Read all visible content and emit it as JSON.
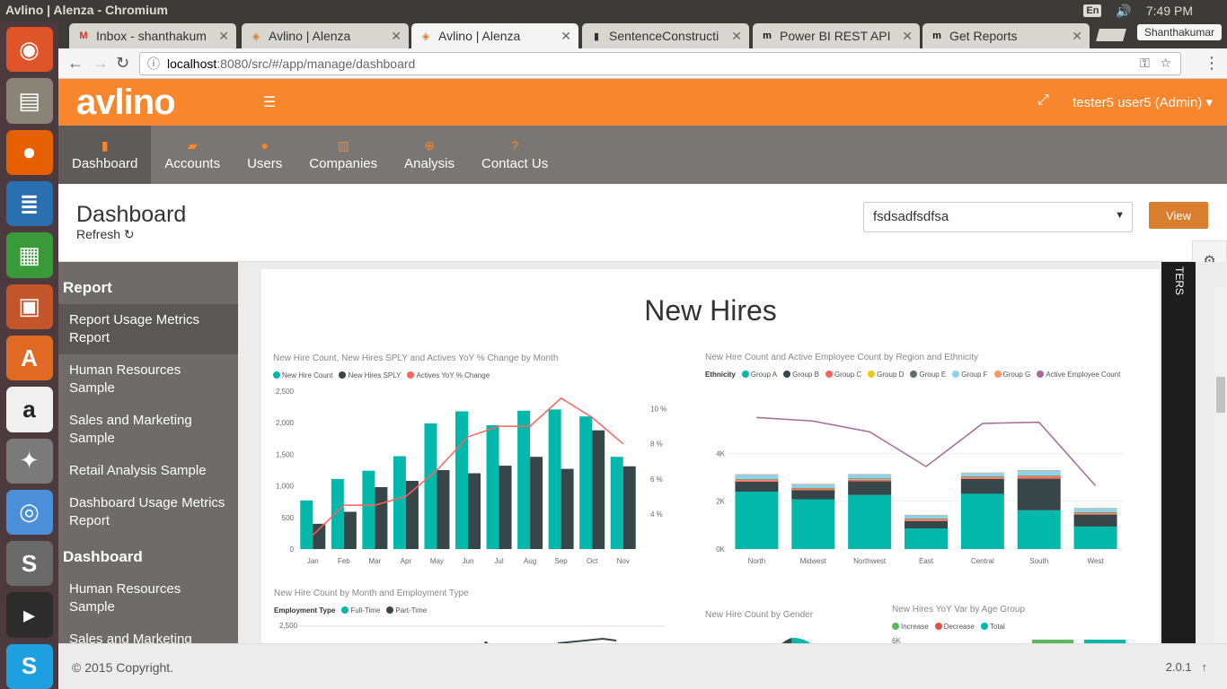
{
  "os": {
    "window_title": "Avlino | Alenza - Chromium",
    "lang": "En",
    "volume_icon": "volume-icon",
    "time": "7:49 PM",
    "user": "Shanthakumar"
  },
  "launcher": [
    {
      "name": "ubuntu-dash-icon",
      "glyph": "◉",
      "color": "#e0542a"
    },
    {
      "name": "files-icon",
      "glyph": "▤",
      "color": "#8a8478"
    },
    {
      "name": "firefox-icon",
      "glyph": "●",
      "color": "#e66000"
    },
    {
      "name": "writer-icon",
      "glyph": "≣",
      "color": "#2a6fb0"
    },
    {
      "name": "calc-icon",
      "glyph": "▦",
      "color": "#3a9a3a"
    },
    {
      "name": "impress-icon",
      "glyph": "▣",
      "color": "#c2552a"
    },
    {
      "name": "software-center-icon",
      "glyph": "A",
      "color": "#e06a24"
    },
    {
      "name": "amazon-icon",
      "glyph": "a",
      "color": "#f0f0f0"
    },
    {
      "name": "settings-icon",
      "glyph": "✦",
      "color": "#7a7a7a"
    },
    {
      "name": "chromium-icon",
      "glyph": "◎",
      "color": "#4a8fd8"
    },
    {
      "name": "sublime-icon",
      "glyph": "S",
      "color": "#6a6a6a"
    },
    {
      "name": "terminal-icon",
      "glyph": "▸",
      "color": "#2c2c2c"
    },
    {
      "name": "skype-icon",
      "glyph": "S",
      "color": "#1ea0e0"
    }
  ],
  "tabs": [
    {
      "label": "Inbox - shanthakum",
      "fav": "M",
      "fav_color": "#d93025",
      "active": false
    },
    {
      "label": "Avlino | Alenza",
      "fav": "◈",
      "fav_color": "#e07b2a",
      "active": false
    },
    {
      "label": "Avlino | Alenza",
      "fav": "◈",
      "fav_color": "#e07b2a",
      "active": true
    },
    {
      "label": "SentenceConstructi",
      "fav": "▮",
      "fav_color": "#333",
      "active": false
    },
    {
      "label": "Power BI REST API",
      "fav": "m",
      "fav_color": "#111",
      "active": false
    },
    {
      "label": "Get Reports",
      "fav": "m",
      "fav_color": "#111",
      "active": false
    }
  ],
  "address": {
    "host": "localhost",
    "rest": ":8080/src/#/app/manage/dashboard"
  },
  "header": {
    "logo": "avlino",
    "user": "tester5 user5 (Admin) ▾"
  },
  "nav": [
    {
      "label": "Dashboard",
      "icon": "bar-chart-icon",
      "glyph": "▮",
      "active": true
    },
    {
      "label": "Accounts",
      "icon": "folder-icon",
      "glyph": "▰",
      "active": false
    },
    {
      "label": "Users",
      "icon": "user-icon",
      "glyph": "●",
      "active": false
    },
    {
      "label": "Companies",
      "icon": "book-icon",
      "glyph": "▥",
      "active": false
    },
    {
      "label": "Analysis",
      "icon": "zoom-icon",
      "glyph": "⊕",
      "active": false
    },
    {
      "label": "Contact Us",
      "icon": "question-icon",
      "glyph": "?",
      "active": false
    }
  ],
  "page": {
    "title": "Dashboard",
    "refresh": "Refresh ↻",
    "select_value": "fsdsadfsdfsa",
    "view_button": "View"
  },
  "sidebar": {
    "report_heading": "Report",
    "report_items": [
      {
        "label": "Report Usage Metrics Report",
        "active": true
      },
      {
        "label": "Human Resources Sample",
        "active": false
      },
      {
        "label": "Sales and Marketing Sample",
        "active": false
      },
      {
        "label": "Retail Analysis Sample",
        "active": false
      },
      {
        "label": "Dashboard Usage Metrics Report",
        "active": false
      }
    ],
    "dashboard_heading": "Dashboard",
    "dashboard_items": [
      {
        "label": "Human Resources Sample",
        "active": false
      },
      {
        "label": "Sales and Marketing",
        "active": false
      }
    ]
  },
  "report": {
    "title": "New Hires",
    "filters_label": "TERS",
    "chart3_title": "New Hire Count by Month and Employment Type",
    "chart3_legend_title": "Employment Type",
    "chart3_legend": [
      {
        "label": "Full-Time",
        "color": "#01b8aa"
      },
      {
        "label": "Part-Time",
        "color": "#374649"
      }
    ],
    "chart3_tick": "2,500",
    "chart4_title": "New Hire Count by Gender",
    "chart5_title": "New Hires YoY Var by Age Group",
    "chart5_legend": [
      {
        "label": "Increase",
        "color": "#5cb85c"
      },
      {
        "label": "Decrease",
        "color": "#d9534f"
      },
      {
        "label": "Total",
        "color": "#01b8aa"
      }
    ],
    "chart5_tick": "6K"
  },
  "chart_data": [
    {
      "type": "bar",
      "title": "New Hire Count, New Hires SPLY and Actives YoY % Change by Month",
      "categories": [
        "Jan",
        "Feb",
        "Mar",
        "Apr",
        "May",
        "Jun",
        "Jul",
        "Aug",
        "Sep",
        "Oct",
        "Nov"
      ],
      "series": [
        {
          "name": "New Hire Count",
          "color": "#01b8aa",
          "values": [
            770,
            1110,
            1240,
            1470,
            1990,
            2180,
            1960,
            2190,
            2210,
            2100,
            1460
          ]
        },
        {
          "name": "New Hires SPLY",
          "color": "#374649",
          "values": [
            400,
            590,
            980,
            1080,
            1250,
            1200,
            1320,
            1460,
            1270,
            1880,
            1310
          ]
        },
        {
          "name": "Actives YoY % Change",
          "color": "#fd625e",
          "line": true,
          "values": [
            2.8,
            4.5,
            4.5,
            5.0,
            6.5,
            8.4,
            9.0,
            9.0,
            10.6,
            9.5,
            8.0
          ]
        }
      ],
      "ylim": [
        0,
        2500
      ],
      "yticks": [
        "0",
        "500",
        "1,000",
        "1,500",
        "2,000",
        "2,500"
      ],
      "y2ticks": [
        "4 %",
        "6 %",
        "8 %",
        "10 %"
      ]
    },
    {
      "type": "bar",
      "title": "New Hire Count and Active Employee Count by Region and Ethnicity",
      "legend_title": "Ethnicity",
      "categories": [
        "North",
        "Midwest",
        "Northwest",
        "East",
        "Central",
        "South",
        "West"
      ],
      "series": [
        {
          "name": "Group A",
          "color": "#01b8aa",
          "values": [
            2400,
            2080,
            2260,
            860,
            2310,
            1620,
            940
          ]
        },
        {
          "name": "Group B",
          "color": "#374649",
          "values": [
            420,
            380,
            580,
            310,
            620,
            1320,
            500
          ]
        },
        {
          "name": "Group C",
          "color": "#fd625e",
          "values": [
            60,
            50,
            60,
            60,
            60,
            90,
            50
          ]
        },
        {
          "name": "Group D",
          "color": "#f2c80f",
          "values": [
            20,
            20,
            20,
            20,
            20,
            20,
            20
          ]
        },
        {
          "name": "Group E",
          "color": "#5f6b6d",
          "values": [
            30,
            30,
            30,
            30,
            30,
            30,
            30
          ]
        },
        {
          "name": "Group F",
          "color": "#8ad4eb",
          "values": [
            180,
            150,
            170,
            130,
            140,
            200,
            160
          ]
        },
        {
          "name": "Group G",
          "color": "#fe9666",
          "values": [
            20,
            20,
            20,
            20,
            20,
            20,
            20
          ]
        },
        {
          "name": "Active Employee Count",
          "color": "#a66999",
          "line": true,
          "values": [
            5500,
            5350,
            4900,
            3450,
            5250,
            5300,
            2650
          ]
        }
      ],
      "ylim": [
        0,
        6000
      ],
      "yticks": [
        "0K",
        "2K",
        "4K"
      ]
    }
  ],
  "footer": {
    "copyright": "© 2015 Copyright.",
    "version": "2.0.1",
    "arrow": "↑"
  }
}
